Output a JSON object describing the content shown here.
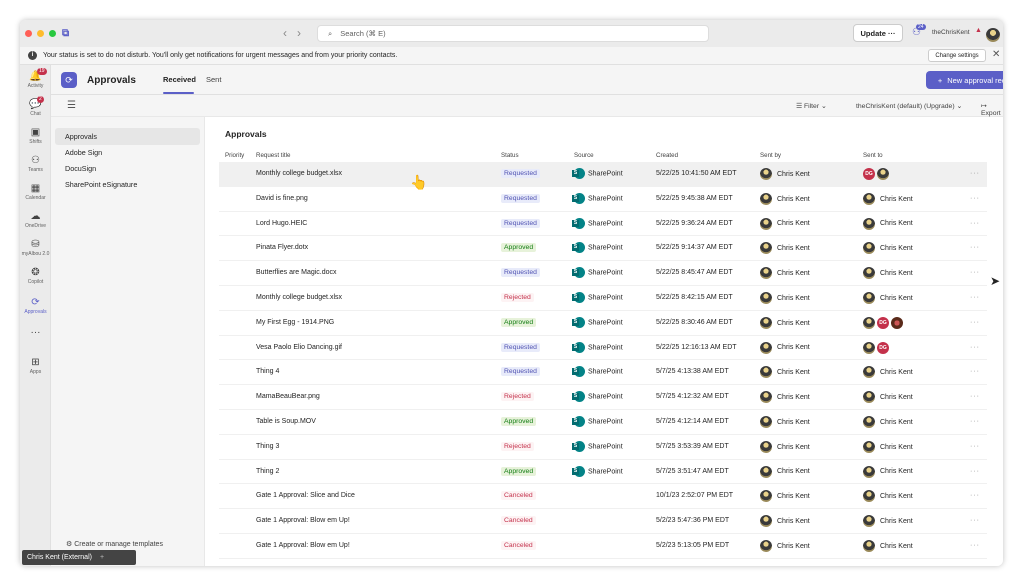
{
  "titlebar": {
    "search_placeholder": "Search (⌘ E)",
    "update_label": "Update",
    "update_more": "···",
    "notifications_count": "24",
    "tenant_name": "theChrisKent"
  },
  "banner": {
    "message": "Your status is set to do not disturb. You'll only get notifications for urgent messages and from your priority contacts.",
    "change_settings_label": "Change settings"
  },
  "rail": [
    {
      "label": "Activity",
      "glyph": "🔔",
      "badge": "19"
    },
    {
      "label": "Chat",
      "glyph": "💬",
      "badge": "2"
    },
    {
      "label": "Shifts",
      "glyph": "▣",
      "badge": ""
    },
    {
      "label": "Teams",
      "glyph": "⚇",
      "badge": ""
    },
    {
      "label": "Calendar",
      "glyph": "▦",
      "badge": ""
    },
    {
      "label": "OneDrive",
      "glyph": "☁",
      "badge": ""
    },
    {
      "label": "myAlbou 2.0",
      "glyph": "⛁",
      "badge": ""
    },
    {
      "label": "Copilot",
      "glyph": "❂",
      "badge": ""
    },
    {
      "label": "Approvals",
      "glyph": "⟳",
      "badge": ""
    },
    {
      "label": "",
      "glyph": "···",
      "badge": ""
    },
    {
      "label": "Apps",
      "glyph": "⊞",
      "badge": ""
    }
  ],
  "app": {
    "title": "Approvals",
    "tabs": [
      "Received",
      "Sent"
    ],
    "new_request_label": "New approval request"
  },
  "toolbar": {
    "filter_label": "Filter",
    "tenant_label": "theChrisKent (default) (Upgrade)",
    "export_label": "Export"
  },
  "sidenav": {
    "items": [
      "Approvals",
      "Adobe Sign",
      "DocuSign",
      "SharePoint eSignature"
    ],
    "templates_label": "Create or manage templates"
  },
  "table": {
    "title": "Approvals",
    "columns": [
      "Priority",
      "Request title",
      "Status",
      "Source",
      "Created",
      "Sent by",
      "Sent to"
    ],
    "rows": [
      {
        "title": "Monthly college budget.xlsx",
        "status": "Requested",
        "source": "SharePoint",
        "created": "5/22/25 10:41:50 AM EDT",
        "sent_by": "Chris Kent",
        "sent_to": "",
        "sent_to_avatars": [
          "DG",
          "photo"
        ]
      },
      {
        "title": "David is fine.png",
        "status": "Requested",
        "source": "SharePoint",
        "created": "5/22/25 9:45:38 AM EDT",
        "sent_by": "Chris Kent",
        "sent_to": "Chris Kent",
        "sent_to_avatars": [
          "photo"
        ]
      },
      {
        "title": "Lord Hugo.HEIC",
        "status": "Requested",
        "source": "SharePoint",
        "created": "5/22/25 9:36:24 AM EDT",
        "sent_by": "Chris Kent",
        "sent_to": "Chris Kent",
        "sent_to_avatars": [
          "photo"
        ]
      },
      {
        "title": "Pinata Flyer.dotx",
        "status": "Approved",
        "source": "SharePoint",
        "created": "5/22/25 9:14:37 AM EDT",
        "sent_by": "Chris Kent",
        "sent_to": "Chris Kent",
        "sent_to_avatars": [
          "photo"
        ]
      },
      {
        "title": "Butterflies are Magic.docx",
        "status": "Requested",
        "source": "SharePoint",
        "created": "5/22/25 8:45:47 AM EDT",
        "sent_by": "Chris Kent",
        "sent_to": "Chris Kent",
        "sent_to_avatars": [
          "photo"
        ]
      },
      {
        "title": "Monthly college budget.xlsx",
        "status": "Rejected",
        "source": "SharePoint",
        "created": "5/22/25 8:42:15 AM EDT",
        "sent_by": "Chris Kent",
        "sent_to": "Chris Kent",
        "sent_to_avatars": [
          "photo"
        ]
      },
      {
        "title": "My First Egg - 1914.PNG",
        "status": "Approved",
        "source": "SharePoint",
        "created": "5/22/25 8:30:46 AM EDT",
        "sent_by": "Chris Kent",
        "sent_to": "",
        "sent_to_avatars": [
          "photo",
          "DG",
          "brown"
        ]
      },
      {
        "title": "Vesa Paolo Elio Dancing.gif",
        "status": "Requested",
        "source": "SharePoint",
        "created": "5/22/25 12:16:13 AM EDT",
        "sent_by": "Chris Kent",
        "sent_to": "",
        "sent_to_avatars": [
          "photo",
          "DG"
        ]
      },
      {
        "title": "Thing 4",
        "status": "Requested",
        "source": "SharePoint",
        "created": "5/7/25 4:13:38 AM EDT",
        "sent_by": "Chris Kent",
        "sent_to": "Chris Kent",
        "sent_to_avatars": [
          "photo"
        ]
      },
      {
        "title": "MamaBeauBear.png",
        "status": "Rejected",
        "source": "SharePoint",
        "created": "5/7/25 4:12:32 AM EDT",
        "sent_by": "Chris Kent",
        "sent_to": "Chris Kent",
        "sent_to_avatars": [
          "photo"
        ]
      },
      {
        "title": "Table is Soup.MOV",
        "status": "Approved",
        "source": "SharePoint",
        "created": "5/7/25 4:12:14 AM EDT",
        "sent_by": "Chris Kent",
        "sent_to": "Chris Kent",
        "sent_to_avatars": [
          "photo"
        ]
      },
      {
        "title": "Thing 3",
        "status": "Rejected",
        "source": "SharePoint",
        "created": "5/7/25 3:53:39 AM EDT",
        "sent_by": "Chris Kent",
        "sent_to": "Chris Kent",
        "sent_to_avatars": [
          "photo"
        ]
      },
      {
        "title": "Thing 2",
        "status": "Approved",
        "source": "SharePoint",
        "created": "5/7/25 3:51:47 AM EDT",
        "sent_by": "Chris Kent",
        "sent_to": "Chris Kent",
        "sent_to_avatars": [
          "photo"
        ]
      },
      {
        "title": "Gate 1 Approval: Slice and Dice",
        "status": "Canceled",
        "source": "",
        "created": "10/1/23 2:52:07 PM EDT",
        "sent_by": "Chris Kent",
        "sent_to": "Chris Kent",
        "sent_to_avatars": [
          "photo"
        ]
      },
      {
        "title": "Gate 1 Approval: Blow em Up!",
        "status": "Canceled",
        "source": "",
        "created": "5/2/23 5:47:36 PM EDT",
        "sent_by": "Chris Kent",
        "sent_to": "Chris Kent",
        "sent_to_avatars": [
          "photo"
        ]
      },
      {
        "title": "Gate 1 Approval: Blow em Up!",
        "status": "Canceled",
        "source": "",
        "created": "5/2/23 5:13:05 PM EDT",
        "sent_by": "Chris Kent",
        "sent_to": "Chris Kent",
        "sent_to_avatars": [
          "photo"
        ]
      }
    ],
    "row_more": "···"
  },
  "footer": {
    "user_label": "Chris Kent (External)"
  }
}
